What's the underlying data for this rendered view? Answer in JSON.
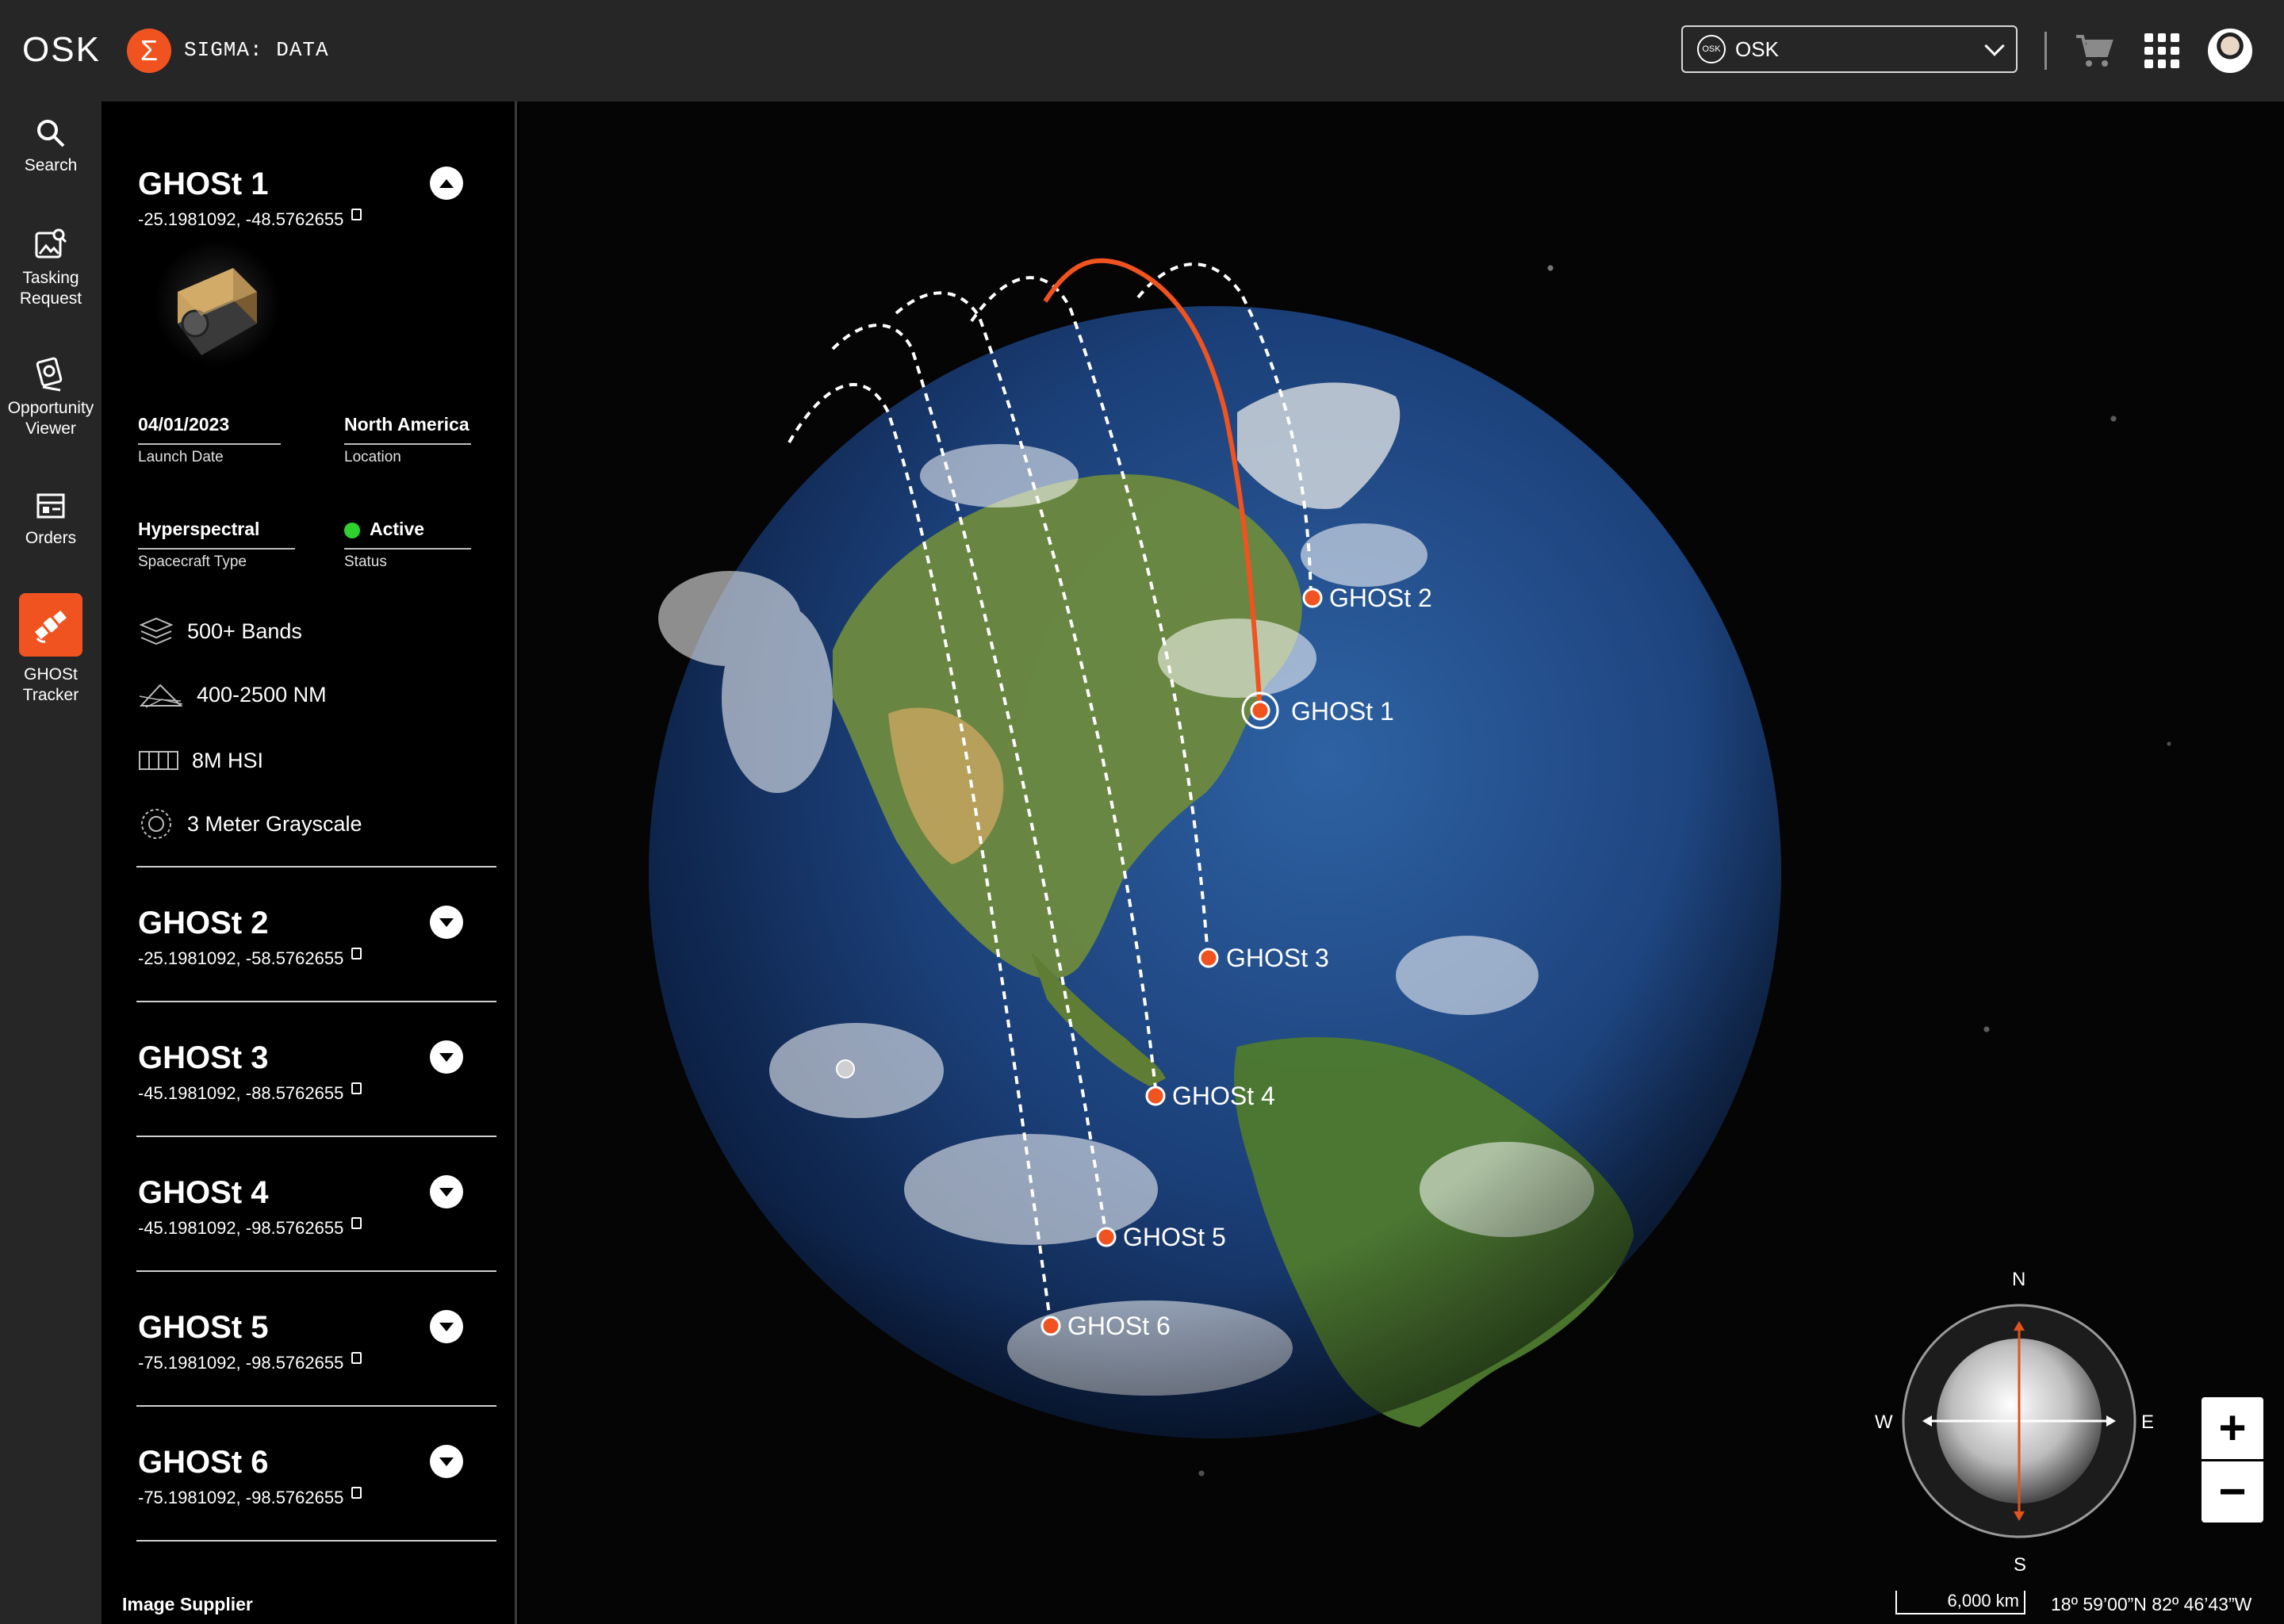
{
  "header": {
    "logo": "OSK",
    "app_name": "SIGMA: DATA",
    "org_select": {
      "badge": "OSK",
      "value": "OSK"
    }
  },
  "nav": [
    {
      "label": "Search",
      "icon": "search-icon"
    },
    {
      "label": "Tasking Request",
      "icon": "image-search-icon"
    },
    {
      "label": "Opportunity Viewer",
      "icon": "opportunity-icon"
    },
    {
      "label": "Orders",
      "icon": "orders-icon"
    },
    {
      "label": "GHOSt Tracker",
      "icon": "satellite-icon",
      "active": true
    }
  ],
  "satellites": [
    {
      "name": "GHOSt 1",
      "coords": "-25.1981092, -48.5762655",
      "expanded": true,
      "launch_date": "04/01/2023",
      "launch_date_label": "Launch Date",
      "location": "North America",
      "location_label": "Location",
      "spacecraft_type": "Hyperspectral",
      "spacecraft_type_label": "Spacecraft Type",
      "status": "Active",
      "status_label": "Status",
      "specs": [
        "500+ Bands",
        "400-2500 NM",
        "8M HSI",
        "3 Meter Grayscale"
      ]
    },
    {
      "name": "GHOSt 2",
      "coords": "-25.1981092, -58.5762655"
    },
    {
      "name": "GHOSt 3",
      "coords": "-45.1981092, -88.5762655"
    },
    {
      "name": "GHOSt 4",
      "coords": "-45.1981092, -98.5762655"
    },
    {
      "name": "GHOSt 5",
      "coords": "-75.1981092, -98.5762655"
    },
    {
      "name": "GHOSt 6",
      "coords": "-75.1981092, -98.5762655"
    }
  ],
  "map_markers": [
    "GHOSt 1",
    "GHOSt 2",
    "GHOSt 3",
    "GHOSt 4",
    "GHOSt 5",
    "GHOSt 6"
  ],
  "compass": {
    "n": "N",
    "s": "S",
    "e": "E",
    "w": "W"
  },
  "zoom": {
    "in": "+",
    "out": "−"
  },
  "footer": {
    "supplier": "Image Supplier",
    "scale": "6,000 km",
    "coords": "18º 59’00”N 82º 46’43”W"
  },
  "colors": {
    "accent": "#f0531f",
    "active_status": "#2fd12f",
    "panel": "#262626"
  }
}
